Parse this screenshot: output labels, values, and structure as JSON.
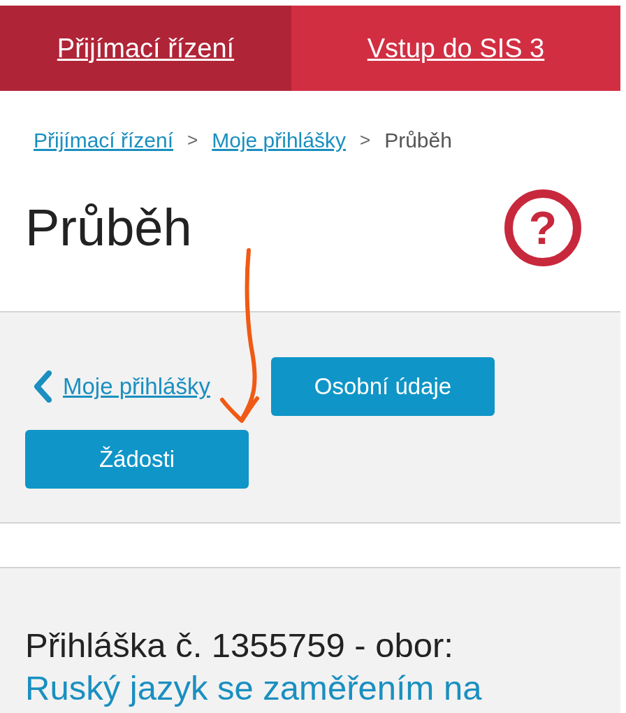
{
  "nav_tabs": [
    {
      "label": "Přijímací řízení",
      "selected": true
    },
    {
      "label": "Vstup do SIS 3",
      "selected": false
    }
  ],
  "breadcrumb": [
    {
      "label": "Přijímací řízení",
      "kind": "link"
    },
    {
      "label": ">",
      "kind": "separator"
    },
    {
      "label": "Moje přihlášky",
      "kind": "link"
    },
    {
      "label": ">",
      "kind": "separator"
    },
    {
      "label": "Průběh",
      "kind": "current"
    }
  ],
  "page_title": "Průběh",
  "help_icon": "?",
  "actions": {
    "back_link": "Moje přihlášky",
    "buttons": [
      "Osobní údaje",
      "Žádosti"
    ]
  },
  "application": {
    "heading": "Přihláška č. 1355759 - obor:",
    "field_link": "Ruský jazyk se zaměřením na"
  }
}
